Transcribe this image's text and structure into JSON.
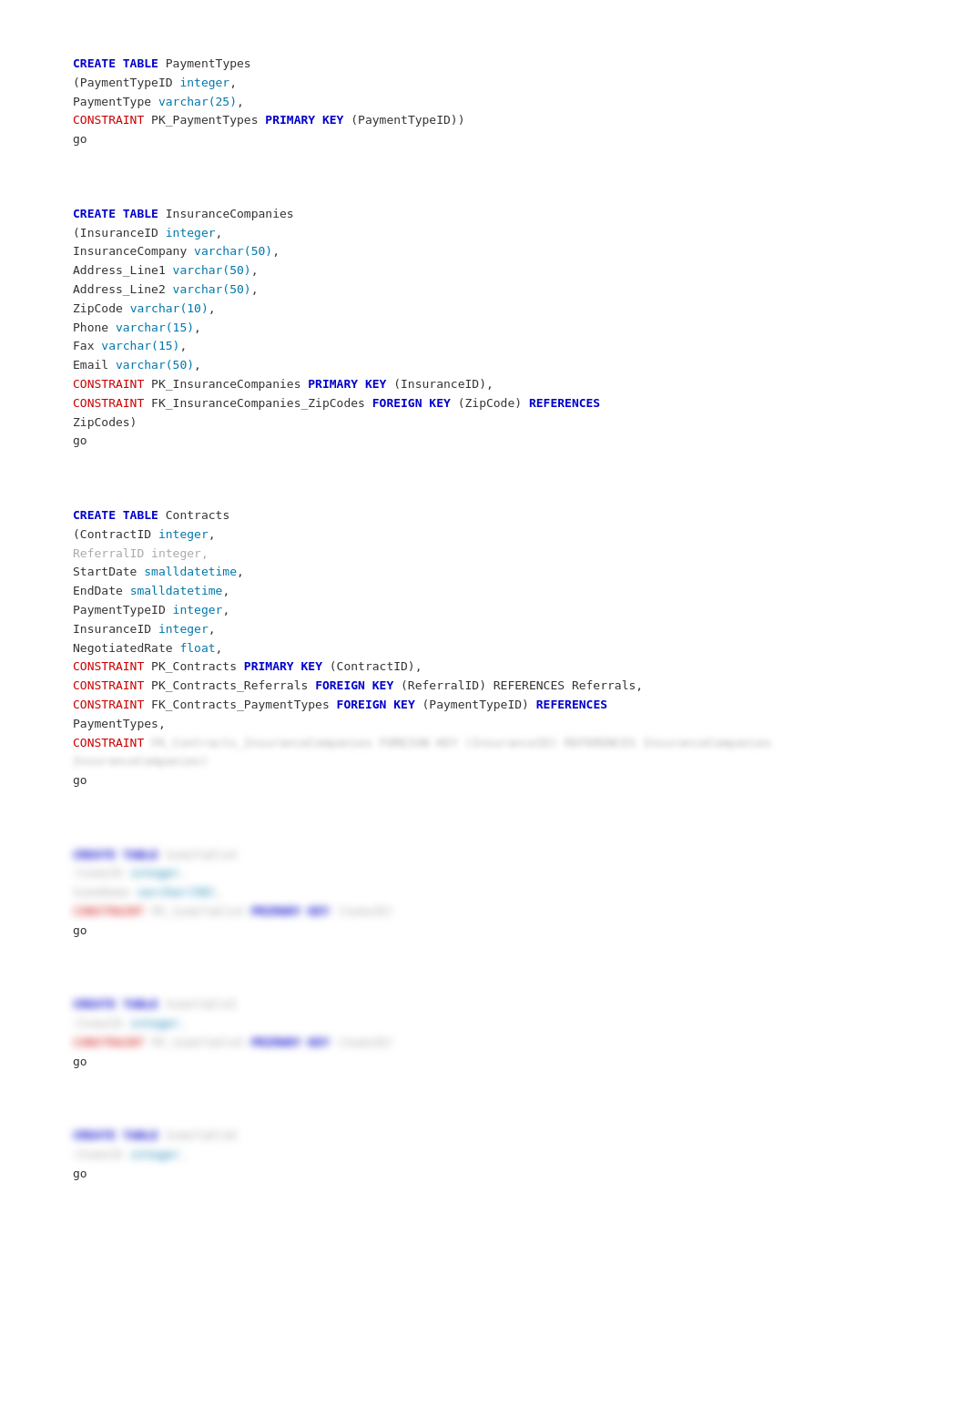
{
  "blocks": [
    {
      "id": "block1",
      "lines": [
        {
          "type": "blank"
        },
        {
          "type": "blank"
        },
        {
          "type": "blank"
        },
        {
          "segments": [
            {
              "text": "CREATE",
              "class": "kw-create"
            },
            {
              "text": " "
            },
            {
              "text": "TABLE",
              "class": "kw-table"
            },
            {
              "text": " PaymentTypes"
            }
          ]
        },
        {
          "segments": [
            {
              "text": "(PaymentTypeID "
            },
            {
              "text": "integer",
              "class": "type-int"
            },
            {
              "text": ","
            }
          ]
        },
        {
          "segments": [
            {
              "text": "PaymentType "
            },
            {
              "text": "varchar(25)",
              "class": "type-varchar"
            },
            {
              "text": ","
            }
          ]
        },
        {
          "segments": [
            {
              "text": "CONSTRAINT",
              "class": "kw-constraint"
            },
            {
              "text": " PK_PaymentTypes "
            },
            {
              "text": "PRIMARY KEY",
              "class": "kw-primary-key"
            },
            {
              "text": " (PaymentTypeID))"
            }
          ]
        },
        {
          "segments": [
            {
              "text": "go"
            }
          ]
        }
      ]
    },
    {
      "id": "block2",
      "lines": [
        {
          "type": "blank"
        },
        {
          "type": "blank"
        },
        {
          "type": "blank"
        },
        {
          "segments": [
            {
              "text": "CREATE",
              "class": "kw-create"
            },
            {
              "text": " "
            },
            {
              "text": "TABLE",
              "class": "kw-table"
            },
            {
              "text": " InsuranceCompanies"
            }
          ]
        },
        {
          "segments": [
            {
              "text": "(InsuranceID "
            },
            {
              "text": "integer",
              "class": "type-int"
            },
            {
              "text": ","
            }
          ]
        },
        {
          "segments": [
            {
              "text": "InsuranceCompany "
            },
            {
              "text": "varchar(50)",
              "class": "type-varchar"
            },
            {
              "text": ","
            }
          ]
        },
        {
          "segments": [
            {
              "text": "Address_Line1 "
            },
            {
              "text": "varchar(50)",
              "class": "type-varchar"
            },
            {
              "text": ","
            }
          ]
        },
        {
          "segments": [
            {
              "text": "Address_Line2 "
            },
            {
              "text": "varchar(50)",
              "class": "type-varchar"
            },
            {
              "text": ","
            }
          ]
        },
        {
          "segments": [
            {
              "text": "ZipCode "
            },
            {
              "text": "varchar(10)",
              "class": "type-varchar"
            },
            {
              "text": ","
            }
          ]
        },
        {
          "segments": [
            {
              "text": "Phone "
            },
            {
              "text": "varchar(15)",
              "class": "type-varchar"
            },
            {
              "text": ","
            }
          ]
        },
        {
          "segments": [
            {
              "text": "Fax "
            },
            {
              "text": "varchar(15)",
              "class": "type-varchar"
            },
            {
              "text": ","
            }
          ]
        },
        {
          "segments": [
            {
              "text": "Email "
            },
            {
              "text": "varchar(50)",
              "class": "type-varchar"
            },
            {
              "text": ","
            }
          ]
        },
        {
          "segments": [
            {
              "text": "CONSTRAINT",
              "class": "kw-constraint"
            },
            {
              "text": " PK_InsuranceCompanies "
            },
            {
              "text": "PRIMARY KEY",
              "class": "kw-primary-key"
            },
            {
              "text": " (InsuranceID),"
            }
          ]
        },
        {
          "segments": [
            {
              "text": "CONSTRAINT",
              "class": "kw-constraint"
            },
            {
              "text": " FK_InsuranceCompanies_ZipCodes "
            },
            {
              "text": "FOREIGN KEY",
              "class": "kw-foreign-key"
            },
            {
              "text": " (ZipCode) "
            },
            {
              "text": "REFERENCES",
              "class": "kw-references"
            }
          ]
        },
        {
          "segments": [
            {
              "text": "ZipCodes)"
            }
          ]
        },
        {
          "segments": [
            {
              "text": "go"
            }
          ]
        }
      ]
    },
    {
      "id": "block3",
      "lines": [
        {
          "type": "blank"
        },
        {
          "type": "blank"
        },
        {
          "type": "blank"
        },
        {
          "segments": [
            {
              "text": "CREATE",
              "class": "kw-create"
            },
            {
              "text": " "
            },
            {
              "text": "TABLE",
              "class": "kw-table"
            },
            {
              "text": " Contracts"
            }
          ]
        },
        {
          "segments": [
            {
              "text": "(ContractID "
            },
            {
              "text": "integer",
              "class": "type-int"
            },
            {
              "text": ","
            }
          ]
        },
        {
          "segments": [
            {
              "text": "ReferralID integer,",
              "class": "text-gray"
            }
          ]
        },
        {
          "segments": [
            {
              "text": "StartDate "
            },
            {
              "text": "smalldatetime",
              "class": "type-small"
            },
            {
              "text": ","
            }
          ]
        },
        {
          "segments": [
            {
              "text": "EndDate "
            },
            {
              "text": "smalldatetime",
              "class": "type-small"
            },
            {
              "text": ","
            }
          ]
        },
        {
          "segments": [
            {
              "text": "PaymentTypeID "
            },
            {
              "text": "integer",
              "class": "type-int"
            },
            {
              "text": ","
            }
          ]
        },
        {
          "segments": [
            {
              "text": "InsuranceID "
            },
            {
              "text": "integer",
              "class": "type-int"
            },
            {
              "text": ","
            }
          ]
        },
        {
          "segments": [
            {
              "text": "NegotiatedRate "
            },
            {
              "text": "float",
              "class": "type-float"
            },
            {
              "text": ","
            }
          ]
        },
        {
          "segments": [
            {
              "text": "CONSTRAINT",
              "class": "kw-constraint"
            },
            {
              "text": " PK_Contracts "
            },
            {
              "text": "PRIMARY KEY",
              "class": "kw-primary-key"
            },
            {
              "text": " (ContractID),"
            }
          ]
        },
        {
          "segments": [
            {
              "text": "CONSTRAINT",
              "class": "kw-constraint"
            },
            {
              "text": " PK_Contracts_Referrals "
            },
            {
              "text": "FOREIGN KEY",
              "class": "kw-foreign-key"
            },
            {
              "text": " (ReferralID) REFERENCES Referrals,"
            }
          ]
        },
        {
          "segments": [
            {
              "text": "CONSTRAINT",
              "class": "kw-constraint"
            },
            {
              "text": " FK_Contracts_PaymentTypes "
            },
            {
              "text": "FOREIGN KEY",
              "class": "kw-foreign-key"
            },
            {
              "text": " (PaymentTypeID) "
            },
            {
              "text": "REFERENCES",
              "class": "kw-references"
            }
          ]
        },
        {
          "segments": [
            {
              "text": "PaymentTypes,"
            }
          ]
        },
        {
          "segments": [
            {
              "text": "CONSTRAINT",
              "class": "kw-constraint"
            },
            {
              "text": " FK_Contracts_InsuranceCompanies",
              "class": "blurred-text"
            }
          ]
        },
        {
          "type": "blank"
        },
        {
          "segments": [
            {
              "text": "go"
            }
          ]
        }
      ]
    },
    {
      "id": "block4",
      "blurred": true,
      "lines": [
        {
          "type": "blank"
        },
        {
          "type": "blank"
        },
        {
          "segments": [
            {
              "text": "CREATE TABLE SomeTable1",
              "class": "blurred"
            }
          ]
        },
        {
          "segments": [
            {
              "text": "(SomeID integer,",
              "class": "blurred"
            }
          ]
        },
        {
          "segments": [
            {
              "text": "CONSTRAINT PK_SomeTable1 PRIMARY KEY (SomeID)",
              "class": "blurred"
            }
          ]
        },
        {
          "segments": [
            {
              "text": "go",
              "class": "blurred"
            }
          ]
        }
      ]
    },
    {
      "id": "block5",
      "blurred": true,
      "lines": [
        {
          "type": "blank"
        },
        {
          "type": "blank"
        },
        {
          "segments": [
            {
              "text": "CREATE TABLE SomeTable2",
              "class": "blurred"
            }
          ]
        },
        {
          "segments": [
            {
              "text": "(SomeID integer,",
              "class": "blurred"
            }
          ]
        },
        {
          "segments": [
            {
              "text": "CONSTRAINT PK_SomeTable2 PRIMARY KEY (SomeID)",
              "class": "blurred"
            }
          ]
        },
        {
          "segments": [
            {
              "text": "go",
              "class": "blurred"
            }
          ]
        }
      ]
    },
    {
      "id": "block6",
      "blurred": true,
      "lines": [
        {
          "type": "blank"
        },
        {
          "type": "blank"
        },
        {
          "segments": [
            {
              "text": "CREATE TABLE SomeTable3",
              "class": "blurred"
            }
          ]
        },
        {
          "segments": [
            {
              "text": "(SomeID integer,",
              "class": "blurred"
            }
          ]
        },
        {
          "segments": [
            {
              "text": "go",
              "class": "blurred"
            }
          ]
        }
      ]
    }
  ]
}
